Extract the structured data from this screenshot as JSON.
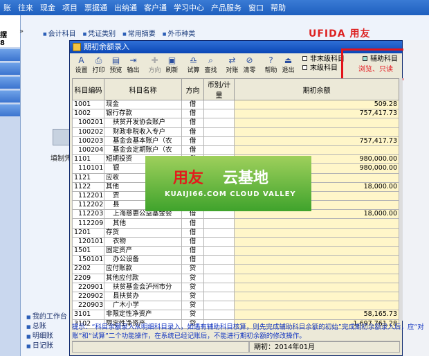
{
  "menubar": [
    "账",
    "往来",
    "现金",
    "项目",
    "票据通",
    "出纳通",
    "客户通",
    "学习中心",
    "产品服务",
    "窗口",
    "帮助"
  ],
  "left_panel": {
    "top_label": "摆",
    "sub_label": "8"
  },
  "bg": {
    "tabs": [
      "会计科目",
      "凭证类别",
      "常用摘要",
      "外币种类"
    ],
    "brand": "UFIDA 用友",
    "icon_label": "填制凭",
    "nav": [
      "我的工作台",
      "总账",
      "明细账",
      "日记账"
    ]
  },
  "dialog": {
    "title": "期初余额录入",
    "toolbar": [
      {
        "label": "设置",
        "icon": "settings-icon",
        "glyph": "A"
      },
      {
        "label": "打印",
        "icon": "print-icon",
        "glyph": "⎙"
      },
      {
        "label": "预览",
        "icon": "preview-icon",
        "glyph": "▤"
      },
      {
        "label": "输出",
        "icon": "export-icon",
        "glyph": "⇥"
      },
      {
        "label": "方向",
        "icon": "direction-icon",
        "glyph": "✚",
        "disabled": true
      },
      {
        "label": "刷新",
        "icon": "refresh-icon",
        "glyph": "▣"
      },
      {
        "label": "试算",
        "icon": "trial-balance-icon",
        "glyph": "♎"
      },
      {
        "label": "查找",
        "icon": "find-icon",
        "glyph": "⌕"
      },
      {
        "label": "对账",
        "icon": "reconcile-icon",
        "glyph": "⇄"
      },
      {
        "label": "清零",
        "icon": "clear-icon",
        "glyph": "⊘"
      },
      {
        "label": "帮助",
        "icon": "help-icon",
        "glyph": "?"
      },
      {
        "label": "退出",
        "icon": "exit-icon",
        "glyph": "⏏"
      }
    ],
    "legend": {
      "nonleaf": "非末级科目",
      "leaf": "末级科目",
      "aux": "辅助科目",
      "aux_note": "浏览、只读"
    },
    "columns": [
      "科目编码",
      "科目名称",
      "方向",
      "币别/计量",
      "期初余额"
    ],
    "rows": [
      [
        "1001",
        "现金",
        "借",
        "",
        "509.28"
      ],
      [
        "1002",
        "银行存款",
        "借",
        "",
        "757,417.73"
      ],
      [
        "100201",
        "扶贫开发协会账户",
        "借",
        "",
        ""
      ],
      [
        "100202",
        "财政非税收入专户",
        "借",
        "",
        ""
      ],
      [
        "100203",
        "基金会基本账户（农",
        "借",
        "",
        "757,417.73"
      ],
      [
        "100204",
        "基金会定期账户（农",
        "借",
        "",
        ""
      ],
      [
        "1101",
        "短期投资",
        "借",
        "",
        "980,000.00"
      ],
      [
        "110101",
        "银",
        "借",
        "",
        "980,000.00"
      ],
      [
        "1121",
        "应收",
        "借",
        "",
        ""
      ],
      [
        "1122",
        "其他",
        "借",
        "",
        "18,000.00"
      ],
      [
        "112201",
        "贾",
        "借",
        "",
        ""
      ],
      [
        "112202",
        "县",
        "借",
        "",
        ""
      ],
      [
        "112203",
        "上海慈惠公益基金会",
        "借",
        "",
        "18,000.00"
      ],
      [
        "112209",
        "其他",
        "借",
        "",
        ""
      ],
      [
        "1201",
        "存货",
        "借",
        "",
        ""
      ],
      [
        "120101",
        "衣物",
        "借",
        "",
        ""
      ],
      [
        "1501",
        "固定资产",
        "借",
        "",
        ""
      ],
      [
        "150101",
        "办公设备",
        "借",
        "",
        ""
      ],
      [
        "2202",
        "应付账款",
        "贷",
        "",
        ""
      ],
      [
        "2209",
        "其他应付款",
        "贷",
        "",
        ""
      ],
      [
        "220901",
        "扶贫基金会泸州市分",
        "贷",
        "",
        ""
      ],
      [
        "220902",
        "县扶贫办",
        "贷",
        "",
        ""
      ],
      [
        "220903",
        "广木小学",
        "贷",
        "",
        ""
      ],
      [
        "3101",
        "非限定性净资产",
        "贷",
        "",
        "58,165.73"
      ],
      [
        "3102",
        "限定性净资产",
        "贷",
        "",
        "1,697,761.28"
      ]
    ],
    "hint": "提示：“科目余额录入从明细科目录入，如遇有辅助科目核算，则先完成辅助科目余额的初始”完成期初余额录入后，应“对账”和“试算”二个功能操作，在系统已经记账后，不能进行期初余额的修改操作。",
    "status_period": "期初：2014年01月"
  },
  "banner": {
    "brand_red": "用友",
    "brand_white": "云基地",
    "sub": "KUAIJI66.COM CLOUD VALLEY"
  }
}
